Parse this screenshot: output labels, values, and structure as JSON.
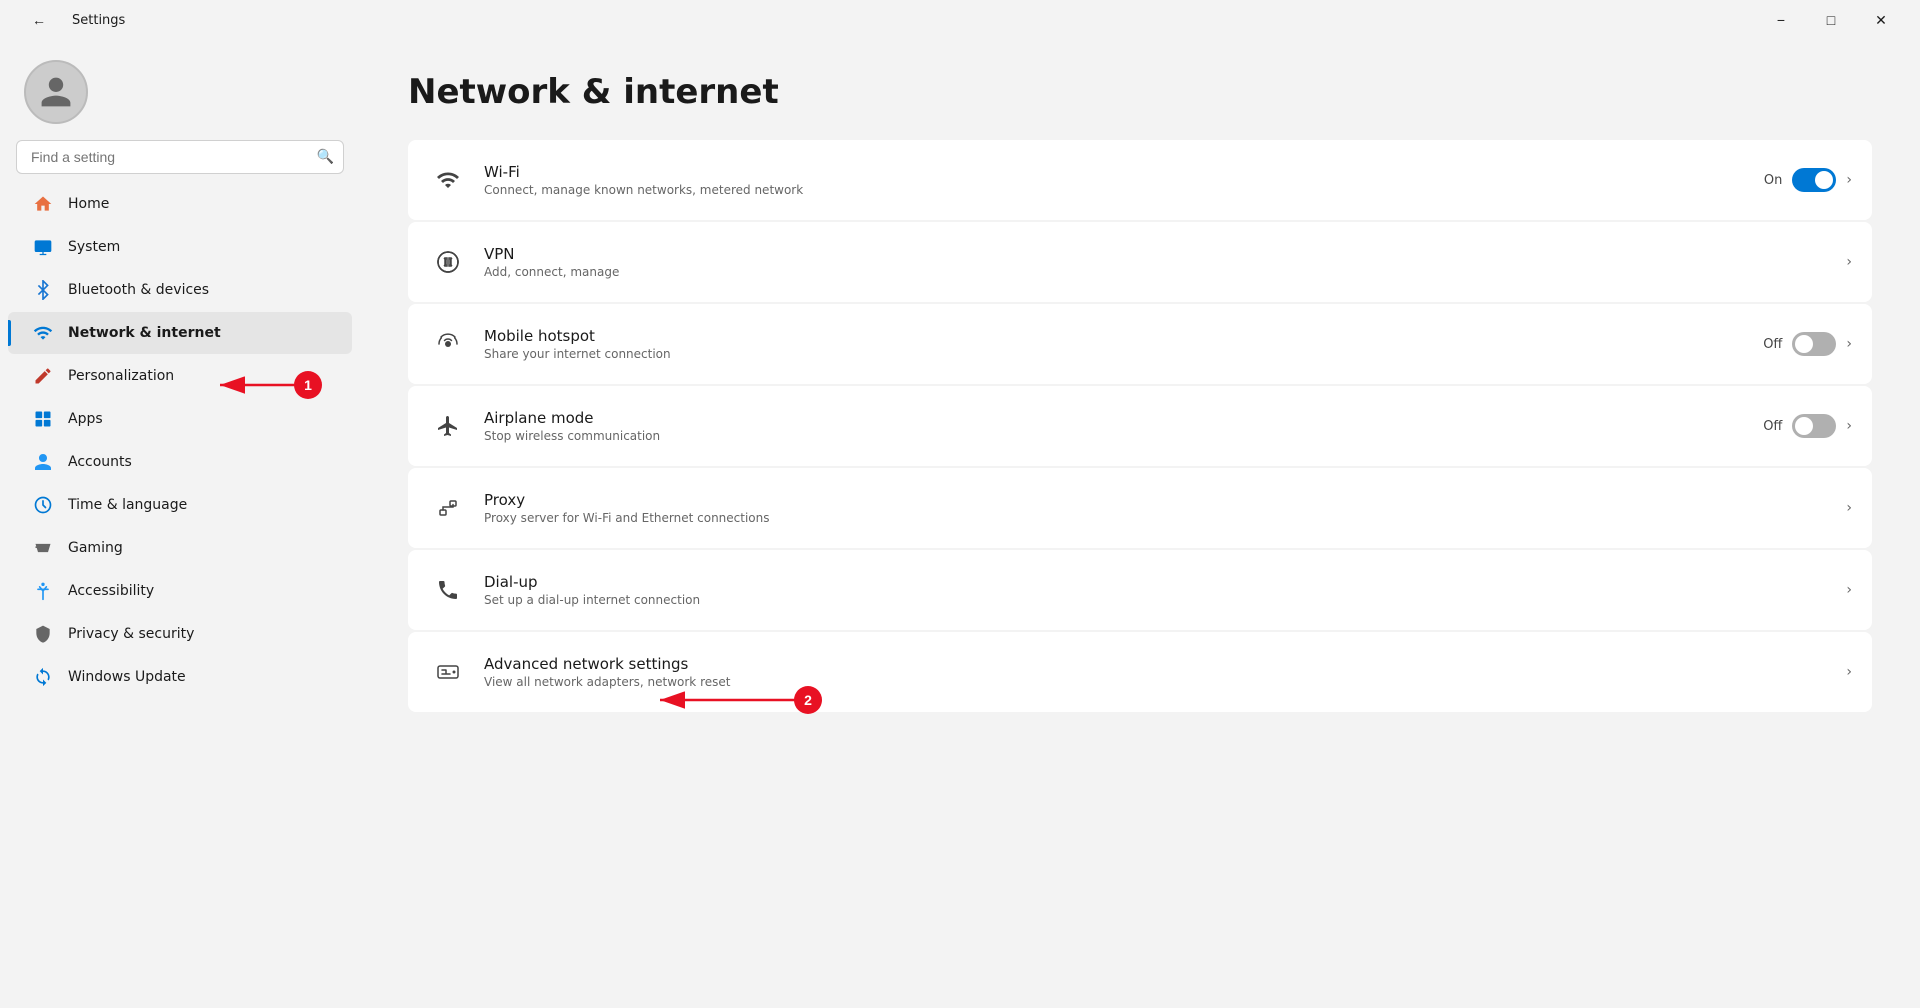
{
  "titleBar": {
    "title": "Settings",
    "backArrow": "←",
    "minimizeLabel": "−",
    "maximizeLabel": "□",
    "closeLabel": "✕"
  },
  "sidebar": {
    "searchPlaceholder": "Find a setting",
    "navItems": [
      {
        "id": "home",
        "label": "Home",
        "icon": "🏠",
        "active": false
      },
      {
        "id": "system",
        "label": "System",
        "icon": "💻",
        "active": false
      },
      {
        "id": "bluetooth",
        "label": "Bluetooth & devices",
        "icon": "🔵",
        "active": false
      },
      {
        "id": "network",
        "label": "Network & internet",
        "icon": "🌐",
        "active": true
      },
      {
        "id": "personalization",
        "label": "Personalization",
        "icon": "✏️",
        "active": false
      },
      {
        "id": "apps",
        "label": "Apps",
        "icon": "📦",
        "active": false
      },
      {
        "id": "accounts",
        "label": "Accounts",
        "icon": "👤",
        "active": false
      },
      {
        "id": "time",
        "label": "Time & language",
        "icon": "🕐",
        "active": false
      },
      {
        "id": "gaming",
        "label": "Gaming",
        "icon": "🎮",
        "active": false
      },
      {
        "id": "accessibility",
        "label": "Accessibility",
        "icon": "♿",
        "active": false
      },
      {
        "id": "privacy",
        "label": "Privacy & security",
        "icon": "🔒",
        "active": false
      },
      {
        "id": "windowsupdate",
        "label": "Windows Update",
        "icon": "🔄",
        "active": false
      }
    ]
  },
  "mainContent": {
    "pageTitle": "Network & internet",
    "settings": [
      {
        "id": "wifi",
        "name": "Wi-Fi",
        "description": "Connect, manage known networks, metered network",
        "hasToggle": true,
        "toggleState": "on",
        "toggleText": "On",
        "hasChevron": true
      },
      {
        "id": "vpn",
        "name": "VPN",
        "description": "Add, connect, manage",
        "hasToggle": false,
        "hasChevron": true
      },
      {
        "id": "hotspot",
        "name": "Mobile hotspot",
        "description": "Share your internet connection",
        "hasToggle": true,
        "toggleState": "off",
        "toggleText": "Off",
        "hasChevron": true
      },
      {
        "id": "airplane",
        "name": "Airplane mode",
        "description": "Stop wireless communication",
        "hasToggle": true,
        "toggleState": "off",
        "toggleText": "Off",
        "hasChevron": true
      },
      {
        "id": "proxy",
        "name": "Proxy",
        "description": "Proxy server for Wi-Fi and Ethernet connections",
        "hasToggle": false,
        "hasChevron": true
      },
      {
        "id": "dialup",
        "name": "Dial-up",
        "description": "Set up a dial-up internet connection",
        "hasToggle": false,
        "hasChevron": true
      },
      {
        "id": "advanced",
        "name": "Advanced network settings",
        "description": "View all network adapters, network reset",
        "hasToggle": false,
        "hasChevron": true
      }
    ]
  },
  "annotations": [
    {
      "id": 1,
      "label": "1"
    },
    {
      "id": 2,
      "label": "2"
    }
  ]
}
